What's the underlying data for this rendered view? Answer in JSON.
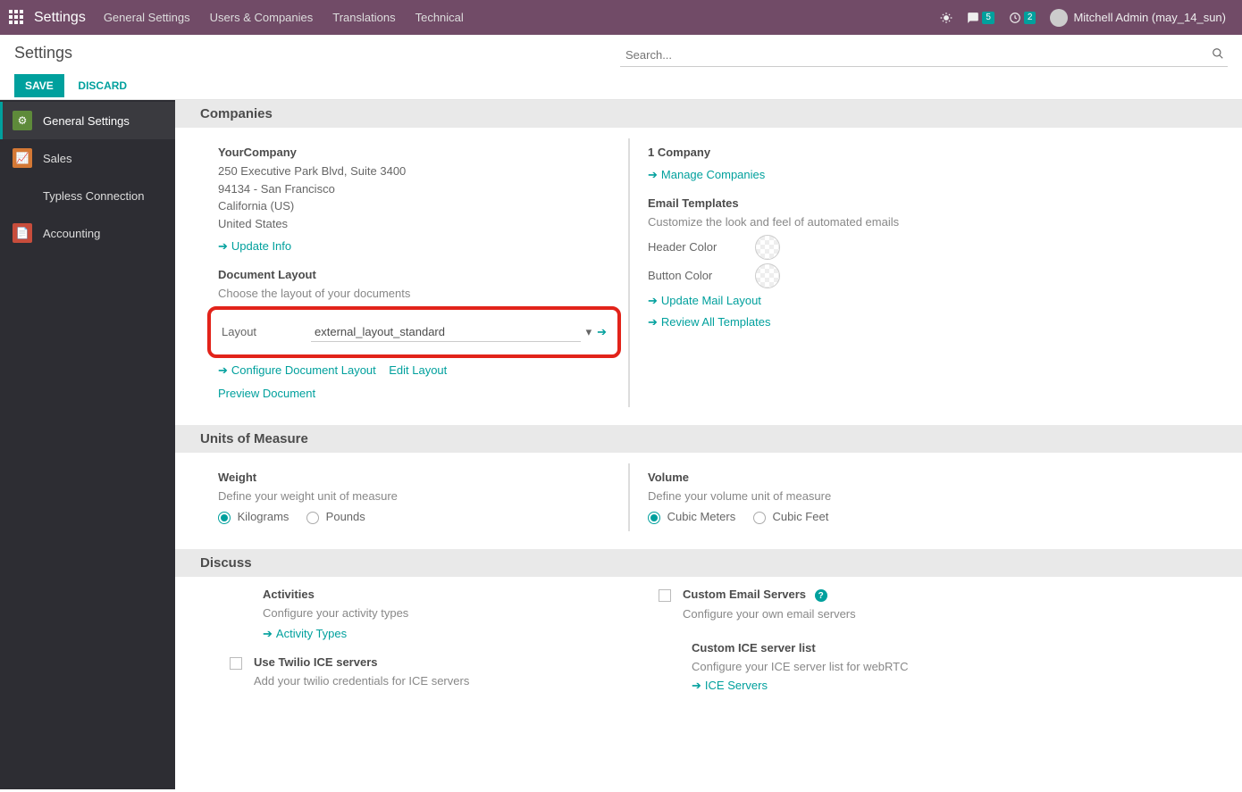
{
  "navbar": {
    "brand": "Settings",
    "menu": [
      "General Settings",
      "Users & Companies",
      "Translations",
      "Technical"
    ],
    "messages_badge": "5",
    "activities_badge": "2",
    "user": "Mitchell Admin (may_14_sun)"
  },
  "control": {
    "title": "Settings",
    "search_placeholder": "Search...",
    "save": "SAVE",
    "discard": "DISCARD"
  },
  "sidebar": {
    "items": [
      {
        "label": "General Settings"
      },
      {
        "label": "Sales"
      },
      {
        "label": "Typless Connection"
      },
      {
        "label": "Accounting"
      }
    ]
  },
  "sections": {
    "companies": {
      "title": "Companies",
      "company_name": "YourCompany",
      "addr1": "250 Executive Park Blvd, Suite 3400",
      "addr2": "94134 - San Francisco",
      "addr3": "California (US)",
      "addr4": "United States",
      "update_info": "Update Info",
      "doc_layout_title": "Document Layout",
      "doc_layout_desc": "Choose the layout of your documents",
      "layout_label": "Layout",
      "layout_value": "external_layout_standard",
      "configure_doc": "Configure Document Layout",
      "edit_layout": "Edit Layout",
      "preview_doc": "Preview Document",
      "company_count": "1 Company",
      "manage_companies": "Manage Companies",
      "email_templates_title": "Email Templates",
      "email_templates_desc": "Customize the look and feel of automated emails",
      "header_color": "Header Color",
      "button_color": "Button Color",
      "update_mail": "Update Mail Layout",
      "review_templates": "Review All Templates"
    },
    "uom": {
      "title": "Units of Measure",
      "weight_title": "Weight",
      "weight_desc": "Define your weight unit of measure",
      "weight_opt1": "Kilograms",
      "weight_opt2": "Pounds",
      "volume_title": "Volume",
      "volume_desc": "Define your volume unit of measure",
      "volume_opt1": "Cubic Meters",
      "volume_opt2": "Cubic Feet"
    },
    "discuss": {
      "title": "Discuss",
      "activities_title": "Activities",
      "activities_desc": "Configure your activity types",
      "activity_types": "Activity Types",
      "custom_email_title": "Custom Email Servers",
      "custom_email_desc": "Configure your own email servers",
      "twilio_title": "Use Twilio ICE servers",
      "twilio_desc": "Add your twilio credentials for ICE servers",
      "ice_list_title": "Custom ICE server list",
      "ice_list_desc": "Configure your ICE server list for webRTC",
      "ice_servers": "ICE Servers"
    }
  }
}
